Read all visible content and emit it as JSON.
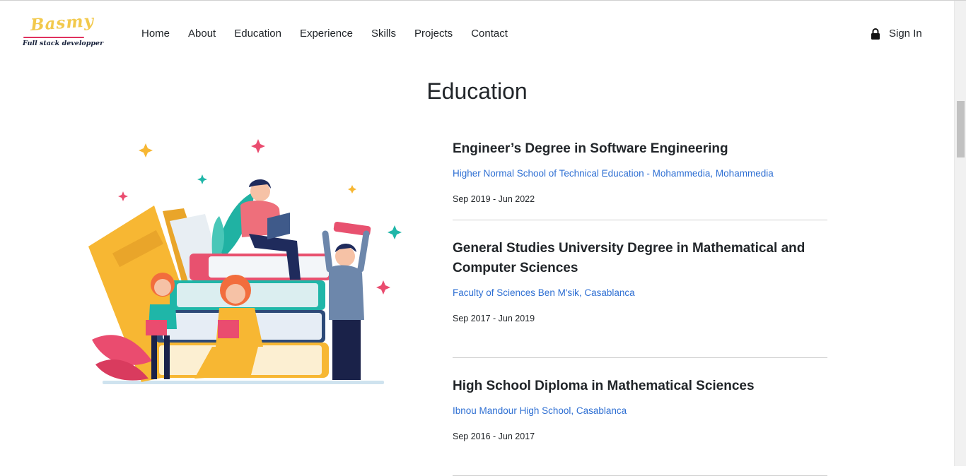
{
  "logo": {
    "name": "Basmy",
    "tagline": "Full stack developper"
  },
  "nav": {
    "items": [
      {
        "label": "Home"
      },
      {
        "label": "About"
      },
      {
        "label": "Education"
      },
      {
        "label": "Experience"
      },
      {
        "label": "Skills"
      },
      {
        "label": "Projects"
      },
      {
        "label": "Contact"
      }
    ],
    "signin_label": "Sign In",
    "signin_icon": "lock-icon"
  },
  "education": {
    "title": "Education",
    "items": [
      {
        "degree": "Engineer’s Degree in Software Engineering",
        "school": "Higher Normal School of Technical Education - Mohammedia, Mohammedia",
        "dates": "Sep 2019 - Jun 2022"
      },
      {
        "degree": "General Studies University Degree in Mathematical and Computer Sciences",
        "school": "Faculty of Sciences Ben M'sik, Casablanca",
        "dates": "Sep 2017 - Jun 2019"
      },
      {
        "degree": "High School Diploma in Mathematical Sciences",
        "school": "Ibnou Mandour High School, Casablanca",
        "dates": "Sep 2016 - Jun 2017"
      }
    ]
  },
  "colors": {
    "link": "#2e6fd3",
    "logo_yellow": "#f2c94c",
    "logo_red": "#e0325e",
    "text": "#212529"
  }
}
